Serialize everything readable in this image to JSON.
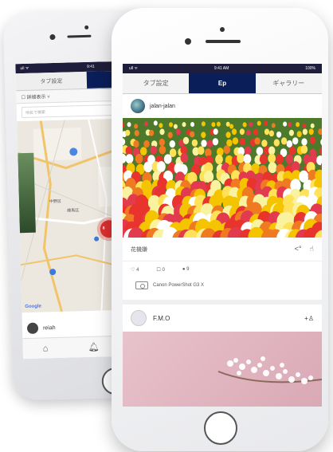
{
  "colors": {
    "accent": "#0a1e5a",
    "status_bar": "#1e1e3c",
    "pin_red": "#e03030",
    "pin_blue": "#3a7ae0"
  },
  "back_phone": {
    "status": {
      "left": "ull ᯤ",
      "center": "9:41"
    },
    "tabs": [
      {
        "label": "タブ設定",
        "active": false
      },
      {
        "label": "Ep",
        "active": true
      }
    ],
    "filter": {
      "left": "☐ 詳細表示 ˅",
      "right": ""
    },
    "search_placeholder": "地名で検索",
    "map": {
      "labels": [
        "中野区",
        "練馬区"
      ],
      "clusters": [
        "8"
      ],
      "google_label": "Google"
    },
    "user": {
      "name": "reiah"
    },
    "bottom_icons": [
      "home-icon",
      "bell-icon",
      "camera-icon"
    ]
  },
  "front_phone": {
    "status": {
      "left": "ull ᯤ",
      "center": "9:41 AM",
      "right": "100%"
    },
    "tabs": [
      {
        "label": "タブ設定",
        "active": false
      },
      {
        "label": "Ep",
        "active": true
      },
      {
        "label": "ギャラリー",
        "active": false
      }
    ],
    "post1": {
      "user": "jalan-jalan",
      "caption": "花機嫌",
      "stats": {
        "likes": "4",
        "comments": "0",
        "views": "9"
      },
      "camera": "Canon PowerShot G3 X"
    },
    "post2": {
      "user": "F.M.O",
      "follow_icon": "+♙"
    }
  }
}
